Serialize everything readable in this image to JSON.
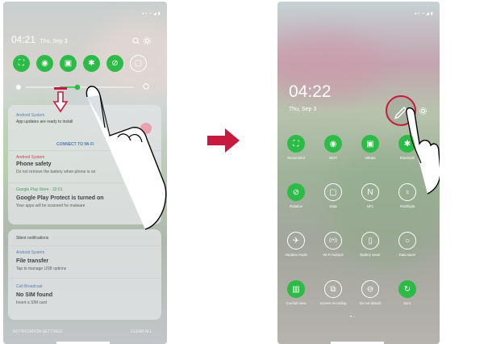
{
  "left_screen": {
    "status_bar": "◂ ◐ ⌁ ◢ ▮",
    "time": "04:21",
    "date": "Thu, Sep 3",
    "search_icon": "search-icon",
    "settings_icon": "gear-icon",
    "quick_settings": [
      {
        "icon": "screenshot-icon",
        "glyph": "⛶",
        "on": true
      },
      {
        "icon": "wifi-icon",
        "glyph": "◉",
        "on": true
      },
      {
        "icon": "vibrate-icon",
        "glyph": "▣",
        "on": true
      },
      {
        "icon": "bluetooth-icon",
        "glyph": "✱",
        "on": true
      },
      {
        "icon": "rotation-icon",
        "glyph": "⊘",
        "on": true
      },
      {
        "icon": "nfc-off-icon",
        "glyph": "▢",
        "on": false
      }
    ],
    "notifications": [
      {
        "app": "Android System",
        "title": "App updates are ready to install",
        "body": "",
        "action": "CONNECT TO Wi-Fi"
      },
      {
        "app": "Android System",
        "title": "Phone safety",
        "body": "Do not remove the battery when phone is on"
      },
      {
        "app": "Google Play Store · 32:01",
        "title": "Google Play Protect is turned on",
        "body": "Your apps will be scanned for malware"
      }
    ],
    "silent_header": "Silent notifications",
    "silent": [
      {
        "app": "Android System",
        "title": "File transfer",
        "body": "Tap to manage USB options"
      },
      {
        "app": "Cell Broadcast",
        "title": "No SIM found",
        "body": "Insert a SIM card"
      }
    ],
    "footer_left": "NOTIFICATION SETTINGS",
    "footer_right": "CLEAR ALL"
  },
  "right_screen": {
    "status_bar": "◂ ◐ ⌁ ◢ ▮",
    "time": "04:22",
    "date": "Thu, Sep 3",
    "edit_icon": "pencil-edit-icon",
    "tiles": [
      {
        "label": "Screenshot",
        "icon": "screenshot-icon",
        "glyph": "⛶",
        "on": true
      },
      {
        "label": "Wi-Fi",
        "icon": "wifi-icon",
        "glyph": "◉",
        "on": true
      },
      {
        "label": "Vibrate",
        "icon": "vibrate-icon",
        "glyph": "▣",
        "on": true
      },
      {
        "label": "Bluetooth",
        "icon": "bluetooth-icon",
        "glyph": "✱",
        "on": true
      },
      {
        "label": "Rotation",
        "icon": "rotation-icon",
        "glyph": "⊘",
        "on": true
      },
      {
        "label": "Data",
        "icon": "data-icon",
        "glyph": "▢",
        "on": false
      },
      {
        "label": "NFC",
        "icon": "nfc-icon",
        "glyph": "N",
        "on": false
      },
      {
        "label": "Flashlight",
        "icon": "flashlight-icon",
        "glyph": "♀",
        "on": false
      },
      {
        "label": "Airplane mode",
        "icon": "airplane-icon",
        "glyph": "✈",
        "on": false
      },
      {
        "label": "Wi-Fi hotspot",
        "icon": "hotspot-icon",
        "glyph": "((•))",
        "on": false
      },
      {
        "label": "Battery saver",
        "icon": "battery-icon",
        "glyph": "▯",
        "on": false
      },
      {
        "label": "Data saver",
        "icon": "data-saver-icon",
        "glyph": "○",
        "on": false
      },
      {
        "label": "Comfort view",
        "icon": "comfort-view-icon",
        "glyph": "▥",
        "on": true
      },
      {
        "label": "Screen recording",
        "icon": "screen-recording-icon",
        "glyph": "⧉",
        "on": false
      },
      {
        "label": "Do not disturb",
        "icon": "do-not-disturb-icon",
        "glyph": "⊖",
        "on": false
      },
      {
        "label": "Sync",
        "icon": "sync-icon",
        "glyph": "↻",
        "on": true
      }
    ],
    "page_dots": "• ◦"
  },
  "colors": {
    "accent_green": "#2dbb47",
    "highlight_ring": "#c8193e",
    "arrow_color": "#c8193e"
  }
}
